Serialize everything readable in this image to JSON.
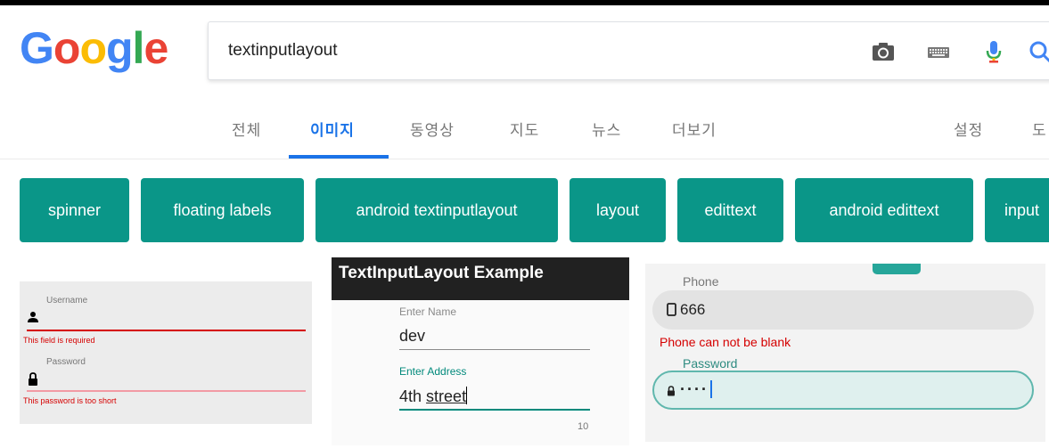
{
  "logo": {
    "letters": [
      "G",
      "o",
      "o",
      "g",
      "l",
      "e"
    ],
    "colors": [
      "#4285f4",
      "#ea4335",
      "#fbbc05",
      "#4285f4",
      "#34a853",
      "#ea4335"
    ]
  },
  "search": {
    "query": "textinputlayout",
    "icons": [
      "camera-icon",
      "keyboard-icon",
      "microphone-icon",
      "search-icon"
    ]
  },
  "tabs": {
    "all": "전체",
    "images": "이미지",
    "videos": "동영상",
    "maps": "지도",
    "news": "뉴스",
    "more": "더보기",
    "settings": "설정",
    "tools": "도",
    "active": "이미지",
    "accent": "#1a73e8"
  },
  "chips": {
    "color": "#0a9688",
    "items": [
      "spinner",
      "floating labels",
      "android textinputlayout",
      "layout",
      "edittext",
      "android edittext",
      "input"
    ]
  },
  "thumb1": {
    "username_label": "Username",
    "username_error": "This field is required",
    "password_label": "Password",
    "password_error": "This password is too short",
    "icons": [
      "person-icon",
      "lock-icon"
    ]
  },
  "thumb2": {
    "title": "TextInputLayout Example",
    "name_label": "Enter Name",
    "name_value": "dev",
    "address_label": "Enter Address",
    "address_value_word1": "4th",
    "address_value_word2": "street",
    "counter": "10"
  },
  "thumb3": {
    "phone_label": "Phone",
    "phone_value": "666",
    "phone_error": "Phone can not be blank",
    "password_label": "Password",
    "password_value": "····",
    "icons": [
      "phone-icon",
      "lock-icon"
    ]
  }
}
